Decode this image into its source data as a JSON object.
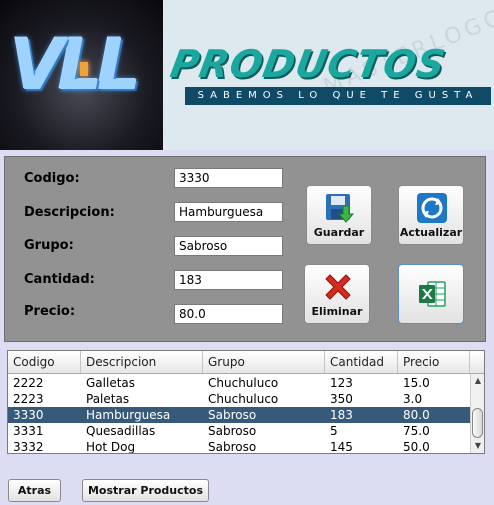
{
  "logo": {
    "monogram": "VLL"
  },
  "banner": {
    "title": "PRODUCTOS",
    "slogan": "SABEMOS LO QUE TE GUSTA",
    "watermark": "MASTERLOGO"
  },
  "form": {
    "codigo_label": "Codigo:",
    "codigo_value": "3330",
    "descripcion_label": "Descripcion:",
    "descripcion_value": "Hamburguesa",
    "grupo_label": "Grupo:",
    "grupo_value": "Sabroso",
    "cantidad_label": "Cantidad:",
    "cantidad_value": "183",
    "precio_label": "Precio:",
    "precio_value": "80.0"
  },
  "actions": {
    "guardar": "Guardar",
    "actualizar": "Actualizar",
    "eliminar": "Eliminar",
    "excel_icon": "excel-icon"
  },
  "table": {
    "headers": [
      "Codigo",
      "Descripcion",
      "Grupo",
      "Cantidad",
      "Precio"
    ],
    "rows": [
      [
        "2222",
        "Galletas",
        "Chuchuluco",
        "123",
        "15.0"
      ],
      [
        "2223",
        "Paletas",
        "Chuchuluco",
        "350",
        "3.0"
      ],
      [
        "3330",
        "Hamburguesa",
        "Sabroso",
        "183",
        "80.0"
      ],
      [
        "3331",
        "Quesadillas",
        "Sabroso",
        "5",
        "75.0"
      ],
      [
        "3332",
        "Hot Dog",
        "Sabroso",
        "145",
        "50.0"
      ]
    ],
    "selected_row": 2
  },
  "footer": {
    "atras": "Atras",
    "mostrar": "Mostrar Productos"
  },
  "colors": {
    "selection": "#375a7a",
    "panel": "#929292",
    "background": "#dcdcf2",
    "title_teal": "#1aa7a0",
    "slogan_bg": "#0f4a66"
  }
}
